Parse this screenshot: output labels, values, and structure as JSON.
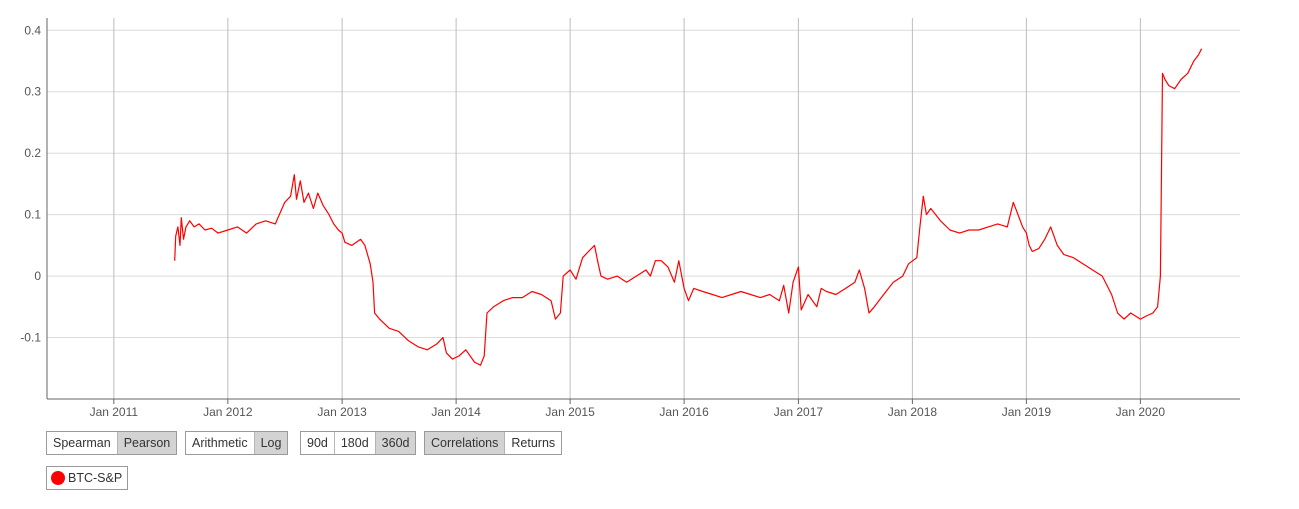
{
  "chart_data": {
    "type": "line",
    "title": "",
    "xlabel": "",
    "ylabel": "",
    "x_ticks": [
      "Jan 2011",
      "Jan 2012",
      "Jan 2013",
      "Jan 2014",
      "Jan 2015",
      "Jan 2016",
      "Jan 2017",
      "Jan 2018",
      "Jan 2019",
      "Jan 2020"
    ],
    "y_ticks": [
      "0.4",
      "0.3",
      "0.2",
      "0.1",
      "0",
      "-0.1"
    ],
    "ylim": [
      -0.2,
      0.42
    ],
    "xlim": [
      "2010-06-01",
      "2020-11-15"
    ],
    "grid": true,
    "series": [
      {
        "name": "BTC-S&P",
        "color": "#ff0000",
        "points": [
          [
            "2011-07-15",
            0.025
          ],
          [
            "2011-07-18",
            0.065
          ],
          [
            "2011-07-25",
            0.08
          ],
          [
            "2011-08-01",
            0.05
          ],
          [
            "2011-08-05",
            0.095
          ],
          [
            "2011-08-12",
            0.06
          ],
          [
            "2011-08-20",
            0.08
          ],
          [
            "2011-09-01",
            0.09
          ],
          [
            "2011-09-15",
            0.08
          ],
          [
            "2011-10-01",
            0.085
          ],
          [
            "2011-10-20",
            0.075
          ],
          [
            "2011-11-10",
            0.078
          ],
          [
            "2011-12-01",
            0.07
          ],
          [
            "2012-01-01",
            0.075
          ],
          [
            "2012-02-01",
            0.08
          ],
          [
            "2012-03-01",
            0.07
          ],
          [
            "2012-04-01",
            0.085
          ],
          [
            "2012-05-01",
            0.09
          ],
          [
            "2012-06-01",
            0.085
          ],
          [
            "2012-07-01",
            0.12
          ],
          [
            "2012-07-20",
            0.13
          ],
          [
            "2012-08-01",
            0.165
          ],
          [
            "2012-08-08",
            0.125
          ],
          [
            "2012-08-20",
            0.155
          ],
          [
            "2012-09-01",
            0.12
          ],
          [
            "2012-09-15",
            0.135
          ],
          [
            "2012-10-01",
            0.11
          ],
          [
            "2012-10-15",
            0.135
          ],
          [
            "2012-11-01",
            0.115
          ],
          [
            "2012-11-20",
            0.1
          ],
          [
            "2012-12-05",
            0.085
          ],
          [
            "2012-12-20",
            0.075
          ],
          [
            "2013-01-01",
            0.07
          ],
          [
            "2013-01-10",
            0.055
          ],
          [
            "2013-02-01",
            0.05
          ],
          [
            "2013-03-01",
            0.06
          ],
          [
            "2013-03-15",
            0.05
          ],
          [
            "2013-04-01",
            0.02
          ],
          [
            "2013-04-10",
            -0.01
          ],
          [
            "2013-04-15",
            -0.06
          ],
          [
            "2013-05-01",
            -0.07
          ],
          [
            "2013-06-01",
            -0.085
          ],
          [
            "2013-07-01",
            -0.09
          ],
          [
            "2013-08-01",
            -0.105
          ],
          [
            "2013-09-01",
            -0.115
          ],
          [
            "2013-10-01",
            -0.12
          ],
          [
            "2013-11-01",
            -0.11
          ],
          [
            "2013-11-20",
            -0.1
          ],
          [
            "2013-12-01",
            -0.125
          ],
          [
            "2013-12-20",
            -0.135
          ],
          [
            "2014-01-10",
            -0.13
          ],
          [
            "2014-02-01",
            -0.12
          ],
          [
            "2014-03-01",
            -0.14
          ],
          [
            "2014-03-20",
            -0.145
          ],
          [
            "2014-04-01",
            -0.13
          ],
          [
            "2014-04-10",
            -0.06
          ],
          [
            "2014-05-01",
            -0.05
          ],
          [
            "2014-06-01",
            -0.04
          ],
          [
            "2014-07-01",
            -0.035
          ],
          [
            "2014-08-01",
            -0.035
          ],
          [
            "2014-09-01",
            -0.025
          ],
          [
            "2014-10-01",
            -0.03
          ],
          [
            "2014-11-01",
            -0.04
          ],
          [
            "2014-11-15",
            -0.07
          ],
          [
            "2014-12-01",
            -0.06
          ],
          [
            "2014-12-10",
            0.0
          ],
          [
            "2015-01-01",
            0.01
          ],
          [
            "2015-01-20",
            -0.005
          ],
          [
            "2015-02-10",
            0.03
          ],
          [
            "2015-03-01",
            0.04
          ],
          [
            "2015-03-20",
            0.05
          ],
          [
            "2015-04-01",
            0.02
          ],
          [
            "2015-04-10",
            0.0
          ],
          [
            "2015-05-01",
            -0.005
          ],
          [
            "2015-06-01",
            0.0
          ],
          [
            "2015-07-01",
            -0.01
          ],
          [
            "2015-08-01",
            0.0
          ],
          [
            "2015-09-01",
            0.01
          ],
          [
            "2015-09-15",
            0.0
          ],
          [
            "2015-10-01",
            0.025
          ],
          [
            "2015-10-20",
            0.025
          ],
          [
            "2015-11-10",
            0.015
          ],
          [
            "2015-12-01",
            -0.01
          ],
          [
            "2015-12-15",
            0.025
          ],
          [
            "2016-01-01",
            -0.02
          ],
          [
            "2016-01-15",
            -0.04
          ],
          [
            "2016-02-01",
            -0.02
          ],
          [
            "2016-03-01",
            -0.025
          ],
          [
            "2016-04-01",
            -0.03
          ],
          [
            "2016-05-01",
            -0.035
          ],
          [
            "2016-06-01",
            -0.03
          ],
          [
            "2016-07-01",
            -0.025
          ],
          [
            "2016-08-01",
            -0.03
          ],
          [
            "2016-09-01",
            -0.035
          ],
          [
            "2016-10-01",
            -0.03
          ],
          [
            "2016-11-01",
            -0.04
          ],
          [
            "2016-11-15",
            -0.015
          ],
          [
            "2016-12-01",
            -0.06
          ],
          [
            "2016-12-15",
            -0.01
          ],
          [
            "2017-01-01",
            0.015
          ],
          [
            "2017-01-10",
            -0.055
          ],
          [
            "2017-02-01",
            -0.03
          ],
          [
            "2017-03-01",
            -0.05
          ],
          [
            "2017-03-15",
            -0.02
          ],
          [
            "2017-04-01",
            -0.025
          ],
          [
            "2017-05-01",
            -0.03
          ],
          [
            "2017-06-01",
            -0.02
          ],
          [
            "2017-07-01",
            -0.01
          ],
          [
            "2017-07-15",
            0.01
          ],
          [
            "2017-08-01",
            -0.02
          ],
          [
            "2017-08-15",
            -0.06
          ],
          [
            "2017-09-01",
            -0.05
          ],
          [
            "2017-10-01",
            -0.03
          ],
          [
            "2017-11-01",
            -0.01
          ],
          [
            "2017-12-01",
            0.0
          ],
          [
            "2017-12-20",
            0.02
          ],
          [
            "2018-01-15",
            0.03
          ],
          [
            "2018-01-25",
            0.08
          ],
          [
            "2018-02-05",
            0.13
          ],
          [
            "2018-02-15",
            0.1
          ],
          [
            "2018-03-01",
            0.11
          ],
          [
            "2018-04-01",
            0.09
          ],
          [
            "2018-05-01",
            0.075
          ],
          [
            "2018-06-01",
            0.07
          ],
          [
            "2018-07-01",
            0.075
          ],
          [
            "2018-08-01",
            0.075
          ],
          [
            "2018-09-01",
            0.08
          ],
          [
            "2018-10-01",
            0.085
          ],
          [
            "2018-11-01",
            0.08
          ],
          [
            "2018-11-20",
            0.12
          ],
          [
            "2018-12-05",
            0.1
          ],
          [
            "2018-12-20",
            0.08
          ],
          [
            "2019-01-01",
            0.07
          ],
          [
            "2019-01-10",
            0.05
          ],
          [
            "2019-01-20",
            0.04
          ],
          [
            "2019-02-10",
            0.045
          ],
          [
            "2019-03-01",
            0.06
          ],
          [
            "2019-03-20",
            0.08
          ],
          [
            "2019-04-10",
            0.05
          ],
          [
            "2019-05-01",
            0.035
          ],
          [
            "2019-06-01",
            0.03
          ],
          [
            "2019-07-01",
            0.02
          ],
          [
            "2019-08-01",
            0.01
          ],
          [
            "2019-09-01",
            0.0
          ],
          [
            "2019-10-01",
            -0.03
          ],
          [
            "2019-10-20",
            -0.06
          ],
          [
            "2019-11-10",
            -0.07
          ],
          [
            "2019-12-01",
            -0.06
          ],
          [
            "2020-01-01",
            -0.07
          ],
          [
            "2020-01-20",
            -0.065
          ],
          [
            "2020-02-10",
            -0.06
          ],
          [
            "2020-02-25",
            -0.05
          ],
          [
            "2020-03-05",
            0.0
          ],
          [
            "2020-03-12",
            0.33
          ],
          [
            "2020-03-20",
            0.32
          ],
          [
            "2020-04-01",
            0.31
          ],
          [
            "2020-04-20",
            0.305
          ],
          [
            "2020-05-10",
            0.32
          ],
          [
            "2020-06-01",
            0.33
          ],
          [
            "2020-06-20",
            0.35
          ],
          [
            "2020-07-05",
            0.36
          ],
          [
            "2020-07-15",
            0.37
          ]
        ]
      }
    ]
  },
  "controls": {
    "correlation_method": {
      "options": [
        "Spearman",
        "Pearson"
      ],
      "selected": "Pearson"
    },
    "scale": {
      "options": [
        "Arithmetic",
        "Log"
      ],
      "selected": "Log"
    },
    "window": {
      "options": [
        "90d",
        "180d",
        "360d"
      ],
      "selected": "360d"
    },
    "view": {
      "options": [
        "Correlations",
        "Returns"
      ],
      "selected": "Correlations"
    }
  },
  "legend": {
    "label": "BTC-S&P",
    "color": "#ff0000"
  }
}
